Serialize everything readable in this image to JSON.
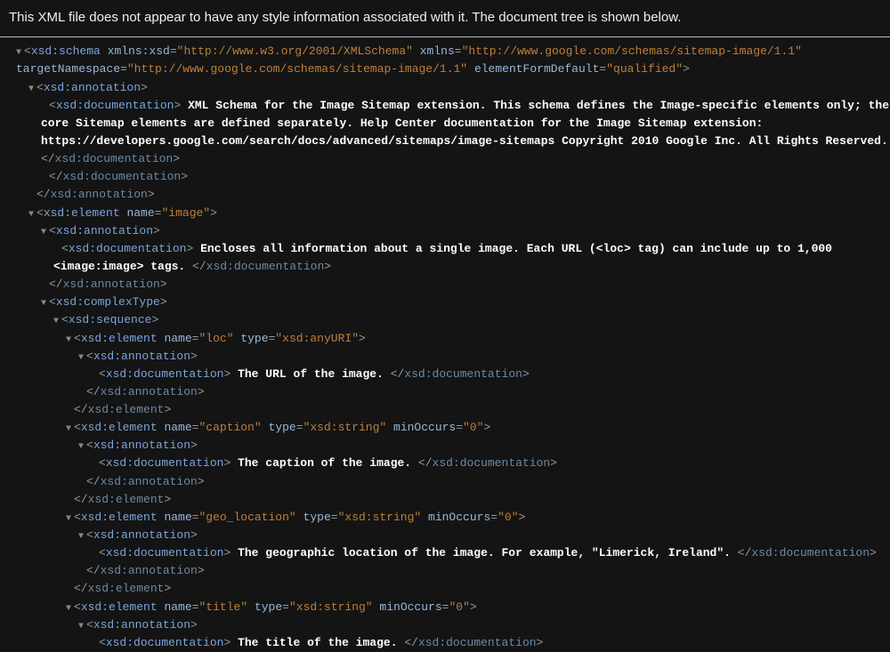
{
  "notice": "This XML file does not appear to have any style information associated with it. The document tree is shown below.",
  "schema": {
    "ns_xsd": "http://www.w3.org/2001/XMLSchema",
    "ns_img": "http://www.google.com/schemas/sitemap-image/1.1",
    "targetNamespace": "http://www.google.com/schemas/sitemap-image/1.1",
    "elementFormDefault": "qualified",
    "doc_schema": "XML Schema for the Image Sitemap extension. This schema defines the Image-specific elements only; the core Sitemap elements are defined separately. Help Center documentation for the Image Sitemap extension: https://developers.google.com/search/docs/advanced/sitemaps/image-sitemaps Copyright 2010 Google Inc. All Rights Reserved.",
    "el_image": {
      "name": "image",
      "doc": "Encloses all information about a single image. Each URL (<loc> tag) can include up to 1,000 <image:image> tags."
    },
    "seq": [
      {
        "name": "loc",
        "type": "xsd:anyURI",
        "minOccurs": null,
        "doc": "The URL of the image."
      },
      {
        "name": "caption",
        "type": "xsd:string",
        "minOccurs": "0",
        "doc": "The caption of the image."
      },
      {
        "name": "geo_location",
        "type": "xsd:string",
        "minOccurs": "0",
        "doc": "The geographic location of the image. For example, \"Limerick, Ireland\"."
      },
      {
        "name": "title",
        "type": "xsd:string",
        "minOccurs": "0",
        "doc": "The title of the image."
      }
    ]
  },
  "tokens": {
    "xsd_schema": "xsd:schema",
    "xsd_annotation": "xsd:annotation",
    "xsd_documentation": "xsd:documentation",
    "xsd_element": "xsd:element",
    "xsd_complexType": "xsd:complexType",
    "xsd_sequence": "xsd:sequence",
    "attr_xmlns_xsd": "xmlns:xsd",
    "attr_xmlns": "xmlns",
    "attr_targetNamespace": "targetNamespace",
    "attr_elementFormDefault": "elementFormDefault",
    "attr_name": "name",
    "attr_type": "type",
    "attr_minOccurs": "minOccurs"
  }
}
